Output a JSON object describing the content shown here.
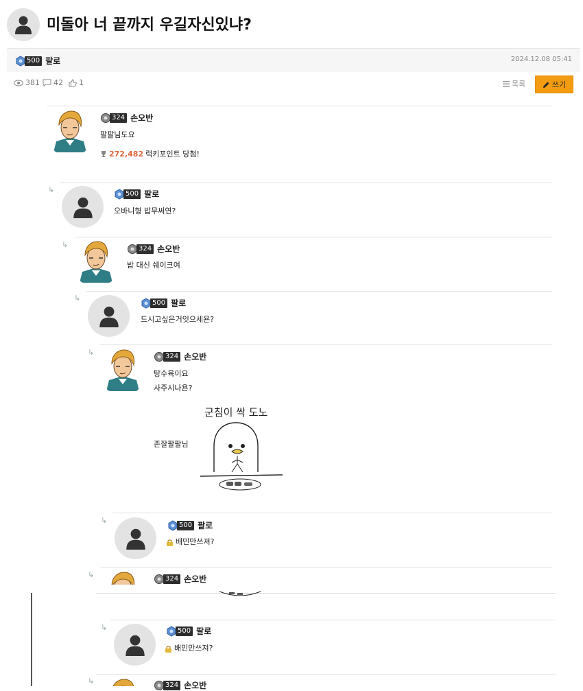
{
  "post": {
    "title": "미돌아 너 끝까지 우길자신있냐?",
    "author": {
      "level": "500",
      "nick": "팔로"
    },
    "date": "2024.12.08 05:41",
    "views": "381",
    "comments": "42",
    "likes": "1",
    "list_label": "목록",
    "write_label": "쓰기"
  },
  "comments": [
    {
      "level": "324",
      "nick": "손오반",
      "lines": [
        "팔팔님도요"
      ],
      "point_value": "272,482",
      "point_suffix": "럭키포인트 당첨!"
    },
    {
      "level": "500",
      "nick": "팔로",
      "lines": [
        "오바니형 밥무써연?"
      ]
    },
    {
      "level": "324",
      "nick": "손오반",
      "lines": [
        "밥 대신 쉐이크여"
      ]
    },
    {
      "level": "500",
      "nick": "팔로",
      "lines": [
        "드시고싶은거잇으세욘?"
      ]
    },
    {
      "level": "324",
      "nick": "손오반",
      "lines": [
        "탕수육이요",
        "사주시나욘?",
        "존잘팔팔님"
      ],
      "image_caption": "군침이 싹 도노"
    },
    {
      "level": "500",
      "nick": "팔로",
      "lines": [
        "배민만쓰져?"
      ]
    },
    {
      "level": "324",
      "nick": "손오반"
    },
    {
      "level": "500",
      "nick": "팔로",
      "lines": [
        "배민만쓰져?"
      ]
    },
    {
      "level": "324",
      "nick": "손오반"
    }
  ],
  "colors": {
    "accent": "#f39c12",
    "point": "#e0663a"
  },
  "icons": [
    "user-silhouette-icon",
    "level-badge-icon",
    "eye-icon",
    "comment-icon",
    "thumbs-up-icon",
    "list-icon",
    "pencil-icon",
    "reply-arrow-icon",
    "trophy-icon",
    "lock-icon"
  ]
}
